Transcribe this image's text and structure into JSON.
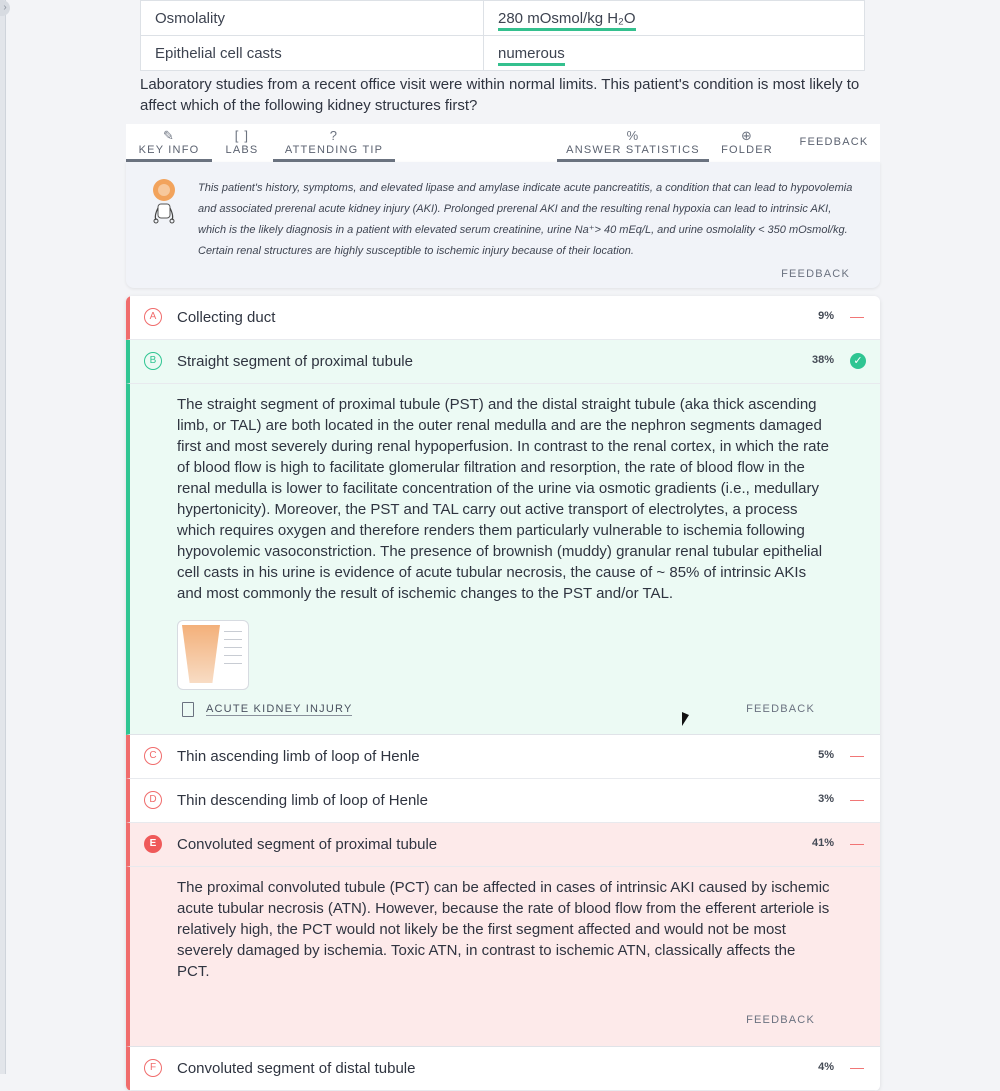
{
  "lab_table": [
    {
      "name": "Osmolality",
      "value": "280 mOsmol/kg H₂O"
    },
    {
      "name": "Epithelial cell casts",
      "value": "numerous"
    }
  ],
  "question": "Laboratory studies from a recent office visit were within normal limits. This patient's condition is most likely to affect which of the following kidney structures first?",
  "toolbar": {
    "key_info": "KEY INFO",
    "labs": "LABS",
    "attending_tip": "ATTENDING TIP",
    "answer_statistics": "ANSWER STATISTICS",
    "folder": "FOLDER",
    "feedback": "FEEDBACK"
  },
  "tip": {
    "text": "This patient's history, symptoms, and elevated lipase and amylase indicate acute pancreatitis, a condition that can lead to hypovolemia and associated prerenal acute kidney injury (AKI). Prolonged prerenal AKI and the resulting renal hypoxia can lead to intrinsic AKI, which is the likely diagnosis in a patient with elevated serum creatinine, urine Na⁺> 40 mEq/L, and urine osmolality < 350 mOsmol/kg. Certain renal structures are highly susceptible to ischemic injury because of their location.",
    "feedback": "FEEDBACK"
  },
  "choices": [
    {
      "letter": "A",
      "text": "Collecting duct",
      "percent": "9%",
      "mark": "—"
    },
    {
      "letter": "B",
      "text": "Straight segment of proximal tubule",
      "percent": "38%",
      "mark": "✓"
    },
    {
      "letter": "C",
      "text": "Thin ascending limb of loop of Henle",
      "percent": "5%",
      "mark": "—"
    },
    {
      "letter": "D",
      "text": "Thin descending limb of loop of Henle",
      "percent": "3%",
      "mark": "—"
    },
    {
      "letter": "E",
      "text": "Convoluted segment of proximal tubule",
      "percent": "41%",
      "mark": "—"
    },
    {
      "letter": "F",
      "text": "Convoluted segment of distal tubule",
      "percent": "4%",
      "mark": "—"
    }
  ],
  "explanation_b": {
    "text": "The straight segment of proximal tubule (PST) and the distal straight tubule (aka thick ascending limb, or TAL) are both located in the outer renal medulla and are the nephron segments damaged first and most severely during renal hypoperfusion. In contrast to the renal cortex, in which the rate of blood flow is high to facilitate glomerular filtration and resorption, the rate of blood flow in the renal medulla is lower to facilitate concentration of the urine via osmotic gradients (i.e., medullary hypertonicity). Moreover, the PST and TAL carry out active transport of electrolytes, a process which requires oxygen and therefore renders them particularly vulnerable to ischemia following hypovolemic vasoconstriction. The presence of brownish (muddy) granular renal tubular epithelial cell casts in his urine is evidence of acute tubular necrosis, the cause of ~ 85% of intrinsic AKIs and most commonly the result of ischemic changes to the PST and/or TAL.",
    "article": "ACUTE KIDNEY INJURY",
    "feedback": "FEEDBACK"
  },
  "explanation_e": {
    "text": "The proximal convoluted tubule (PCT) can be affected in cases of intrinsic AKI caused by ischemic acute tubular necrosis (ATN). However, because the rate of blood flow from the efferent arteriole is relatively high, the PCT would not likely be the first segment affected and would not be most severely damaged by ischemia. Toxic ATN, in contrast to ischemic ATN, classically affects the PCT.",
    "feedback": "FEEDBACK"
  },
  "colors": {
    "correct": "#2fc592",
    "incorrect": "#f06c6c",
    "correct_bg": "#ecfaf4",
    "incorrect_bg": "#fdeaea"
  }
}
